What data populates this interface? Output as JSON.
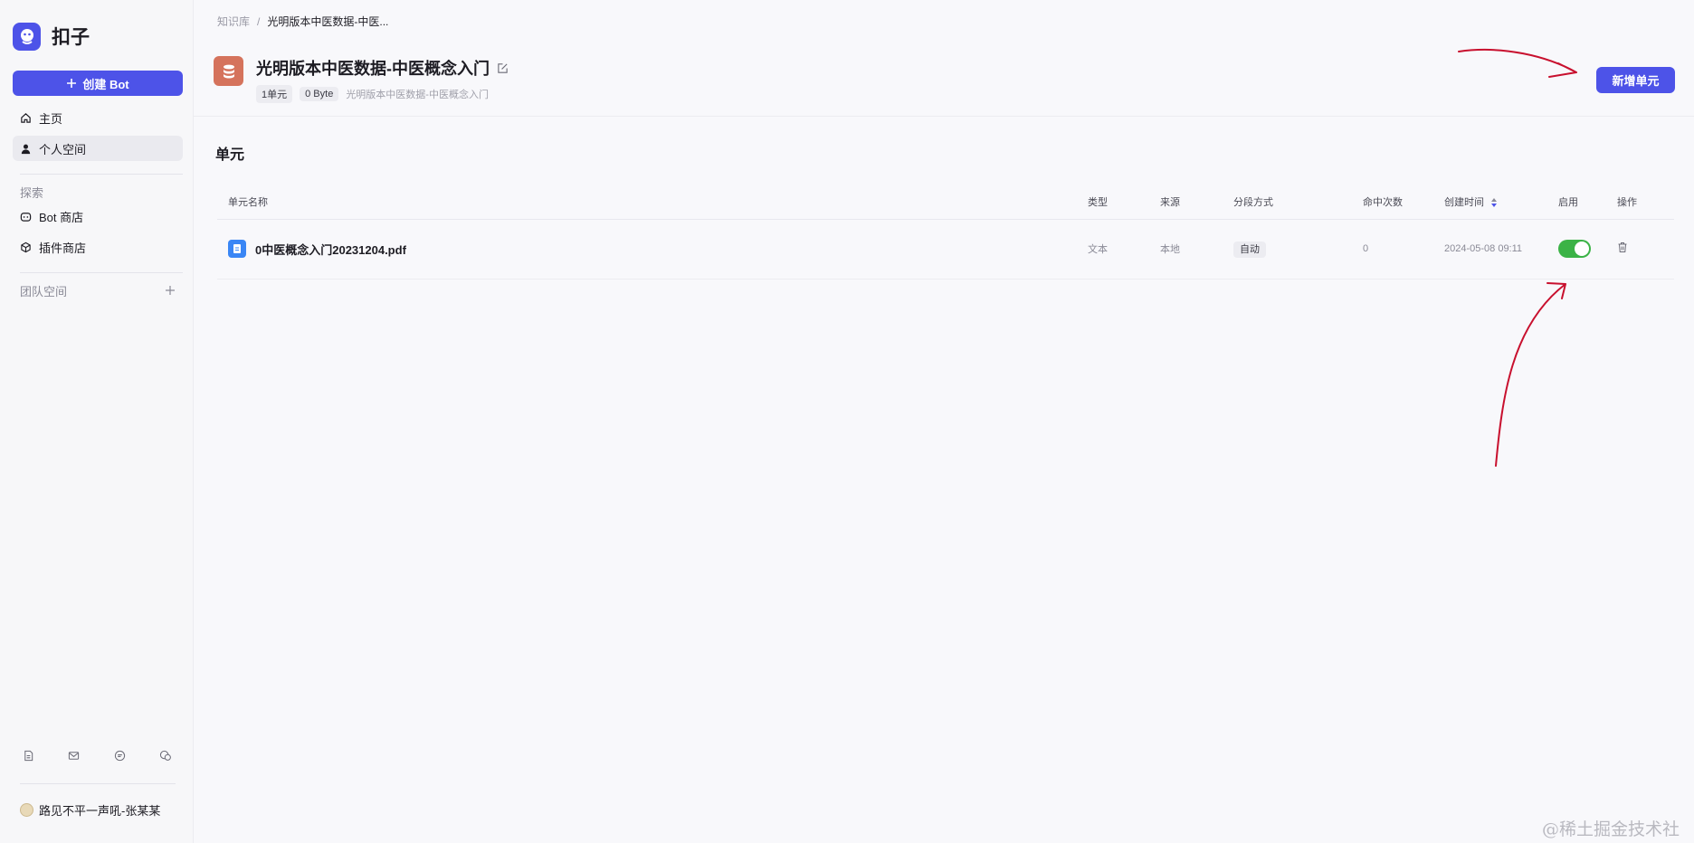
{
  "brand": {
    "name": "扣子"
  },
  "sidebar": {
    "create_label": "创建 Bot",
    "nav": [
      {
        "label": "主页",
        "icon": "home-icon"
      },
      {
        "label": "个人空间",
        "icon": "user-icon"
      }
    ],
    "explore_label": "探索",
    "explore_items": [
      {
        "label": "Bot 商店",
        "icon": "bot-icon"
      },
      {
        "label": "插件商店",
        "icon": "cube-icon"
      }
    ],
    "team_label": "团队空间",
    "bottom_icons": [
      "document-icon",
      "mail-icon",
      "chat-icon",
      "wechat-icon"
    ],
    "user_name": "路见不平一声吼-张某某"
  },
  "breadcrumb": {
    "root": "知识库",
    "separator": "/",
    "current": "光明版本中医数据-中医..."
  },
  "knowledge": {
    "title": "光明版本中医数据-中医概念入门",
    "units_tag": "1单元",
    "size_tag": "0 Byte",
    "description": "光明版本中医数据-中医概念入门",
    "add_button": "新增单元"
  },
  "section_title": "单元",
  "table": {
    "columns": [
      "单元名称",
      "类型",
      "来源",
      "分段方式",
      "命中次数",
      "创建时间",
      "启用",
      "操作"
    ],
    "rows": [
      {
        "name": "0中医概念入门20231204.pdf",
        "type": "文本",
        "source": "本地",
        "segmentation": "自动",
        "hits": "0",
        "created": "2024-05-08 09:11",
        "enabled": true
      }
    ]
  },
  "colors": {
    "primary": "#4d53e8",
    "toggle_on": "#3bb346",
    "annotation": "#c8102e"
  },
  "watermark": "@稀土掘金技术社区"
}
